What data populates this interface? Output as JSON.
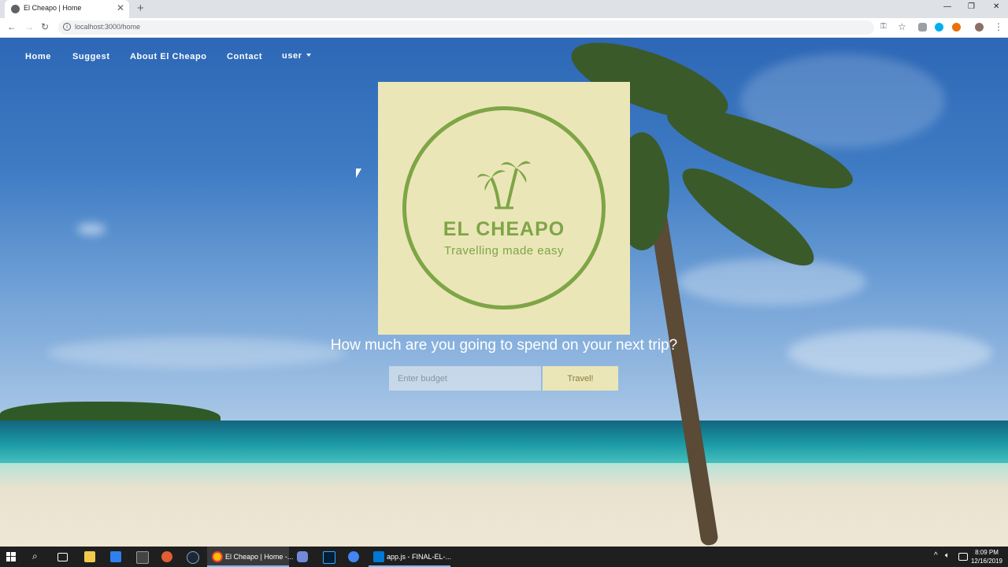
{
  "browser": {
    "tab_title": "El Cheapo | Home",
    "new_tab": "+",
    "close": "✕",
    "url": "localhost:3000/home",
    "window_controls": [
      "—",
      "❐",
      "✕"
    ]
  },
  "nav": {
    "items": [
      "Home",
      "Suggest",
      "About El Cheapo",
      "Contact"
    ],
    "user_label": "user"
  },
  "logo": {
    "title": "EL CHEAPO",
    "tagline": "Travelling made easy"
  },
  "hero": {
    "question": "How much are you going to spend on your next trip?",
    "budget_placeholder": "Enter budget",
    "travel_button": "Travel!"
  },
  "taskbar": {
    "chrome_task": "El Cheapo | Home -...",
    "vscode_task": "app.js - FINAL-EL-...",
    "time": "8:09 PM",
    "date": "12/16/2019"
  }
}
